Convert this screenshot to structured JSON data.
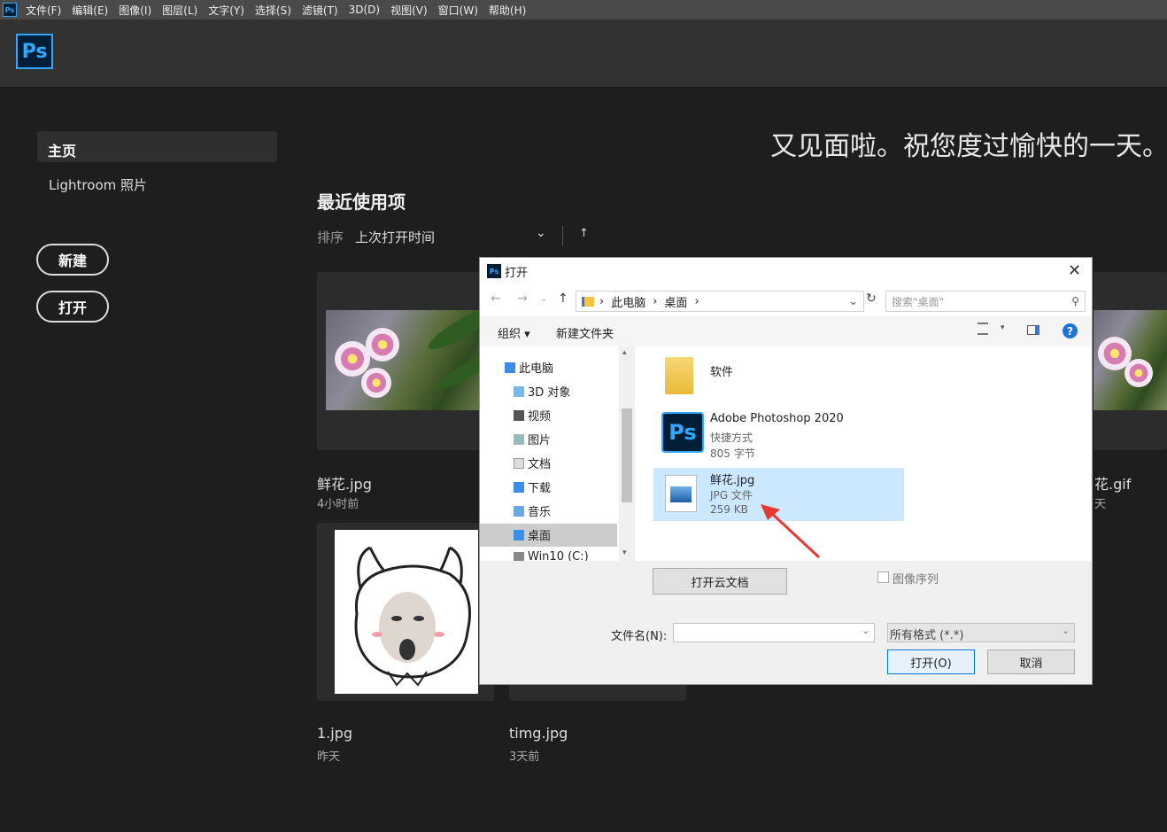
{
  "menubar": {
    "logo": "Ps",
    "items": [
      "文件(F)",
      "编辑(E)",
      "图像(I)",
      "图层(L)",
      "文字(Y)",
      "选择(S)",
      "滤镜(T)",
      "3D(D)",
      "视图(V)",
      "窗口(W)",
      "帮助(H)"
    ]
  },
  "app": {
    "logo": "Ps"
  },
  "sidebar": {
    "home": "主页",
    "lightroom": "Lightroom 照片",
    "new_button": "新建",
    "open_button": "打开"
  },
  "main": {
    "welcome": "又见面啦。祝您度过愉快的一天。",
    "recent_title": "最近使用项",
    "sort_label": "排序",
    "sort_value": "上次打开时间",
    "files": [
      {
        "name": "鲜花.jpg",
        "meta": "4小时前"
      },
      {
        "name": "花.gif",
        "meta": "天"
      },
      {
        "name": "1.jpg",
        "meta": "昨天"
      },
      {
        "name": "timg.jpg",
        "meta": "3天前"
      }
    ]
  },
  "dialog": {
    "title": "打开",
    "close": "✕",
    "breadcrumb": [
      "此电脑",
      "桌面"
    ],
    "search_placeholder": "搜索\"桌面\"",
    "toolbar": {
      "organize": "组织 ▾",
      "new_folder": "新建文件夹"
    },
    "tree": [
      "此电脑",
      "3D 对象",
      "视频",
      "图片",
      "文档",
      "下载",
      "音乐",
      "桌面",
      "Win10 (C:)"
    ],
    "files": [
      {
        "name": "软件",
        "type": "",
        "size": ""
      },
      {
        "name": "Adobe Photoshop 2020",
        "type": "快捷方式",
        "size": "805 字节"
      },
      {
        "name": "鲜花.jpg",
        "type": "JPG 文件",
        "size": "259 KB"
      }
    ],
    "cloud_button": "打开云文档",
    "image_sequence": "图像序列",
    "filename_label": "文件名(N):",
    "filename_value": "",
    "format_value": "所有格式 (*.*)",
    "open_button": "打开(O)",
    "cancel_button": "取消"
  }
}
